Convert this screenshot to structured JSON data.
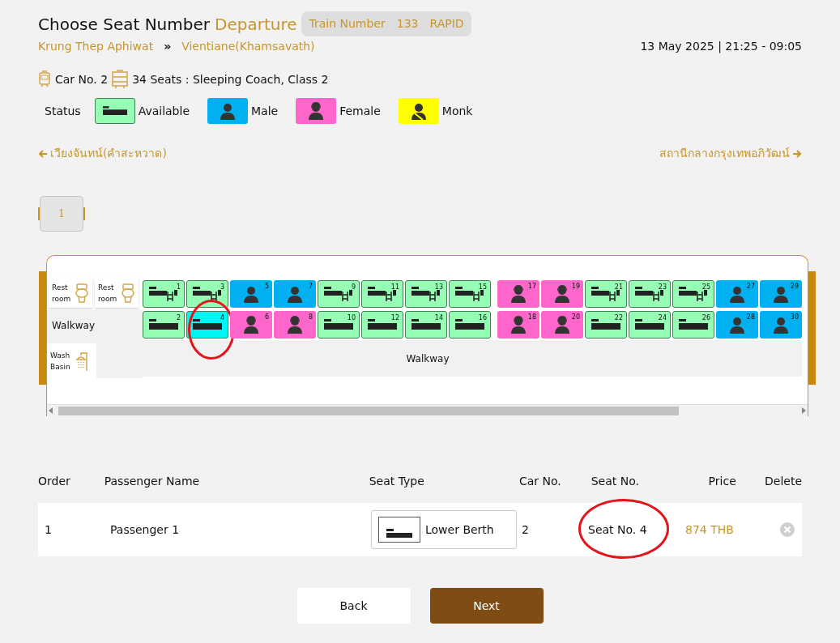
{
  "header": {
    "title": "Choose Seat Number",
    "direction": "Departure",
    "train_badge": {
      "label": "Train Number",
      "number": "133",
      "type": "RAPID"
    }
  },
  "route": {
    "origin": "Krung Thep Aphiwat",
    "separator": "»",
    "destination": "Vientiane(Khamsavath)",
    "datetime": "13 May 2025 | 21:25 - 09:05"
  },
  "car": {
    "car_no": "Car No. 2",
    "seats": "34 Seats : Sleeping Coach, Class 2"
  },
  "legend": {
    "label": "Status",
    "items": [
      {
        "label": "Available",
        "kind": "available"
      },
      {
        "label": "Male",
        "kind": "male"
      },
      {
        "label": "Female",
        "kind": "female"
      },
      {
        "label": "Monk",
        "kind": "monk"
      }
    ]
  },
  "direction_links": {
    "left": "เวียงจันทน์(คำสะหวาด)",
    "right": "สถานีกลางกรุงเทพอภิวัฒน์"
  },
  "car_tabs": [
    {
      "label": "1",
      "selected": false
    }
  ],
  "seat_map": {
    "facilities": [
      {
        "label": "Rest room",
        "kind": "toilet"
      },
      {
        "label": "Rest room",
        "kind": "toilet"
      }
    ],
    "walkway_side": "Walkway",
    "wash_basin": {
      "label": "Wash Basin",
      "kind": "basin"
    },
    "walkway_bottom": "Walkway",
    "upper": [
      {
        "number": "1",
        "kind": "available",
        "selected": false,
        "circled": false
      },
      {
        "number": "3",
        "kind": "available",
        "selected": false,
        "circled": false
      },
      {
        "number": "5",
        "kind": "male",
        "selected": false,
        "circled": false
      },
      {
        "number": "7",
        "kind": "male",
        "selected": false,
        "circled": false
      },
      {
        "number": "9",
        "kind": "available",
        "selected": false,
        "circled": false
      },
      {
        "number": "11",
        "kind": "available",
        "selected": false,
        "circled": false
      },
      {
        "number": "13",
        "kind": "available",
        "selected": false,
        "circled": false
      },
      {
        "number": "15",
        "kind": "available",
        "selected": false,
        "circled": false
      },
      {
        "number": "17",
        "kind": "female",
        "selected": false,
        "circled": false
      },
      {
        "number": "19",
        "kind": "female",
        "selected": false,
        "circled": false
      },
      {
        "number": "21",
        "kind": "available",
        "selected": false,
        "circled": false
      },
      {
        "number": "23",
        "kind": "available",
        "selected": false,
        "circled": false
      },
      {
        "number": "25",
        "kind": "available",
        "selected": false,
        "circled": false
      },
      {
        "number": "27",
        "kind": "male",
        "selected": false,
        "circled": false
      },
      {
        "number": "29",
        "kind": "male",
        "selected": false,
        "circled": false
      }
    ],
    "lower": [
      {
        "number": "2",
        "kind": "available",
        "selected": false,
        "circled": false
      },
      {
        "number": "4",
        "kind": "available",
        "selected": true,
        "circled": true
      },
      {
        "number": "6",
        "kind": "female",
        "selected": false,
        "circled": false
      },
      {
        "number": "8",
        "kind": "female",
        "selected": false,
        "circled": false
      },
      {
        "number": "10",
        "kind": "available",
        "selected": false,
        "circled": false
      },
      {
        "number": "12",
        "kind": "available",
        "selected": false,
        "circled": false
      },
      {
        "number": "14",
        "kind": "available",
        "selected": false,
        "circled": false
      },
      {
        "number": "16",
        "kind": "available",
        "selected": false,
        "circled": false
      },
      {
        "number": "18",
        "kind": "female",
        "selected": false,
        "circled": false
      },
      {
        "number": "20",
        "kind": "female",
        "selected": false,
        "circled": false
      },
      {
        "number": "22",
        "kind": "available",
        "selected": false,
        "circled": false
      },
      {
        "number": "24",
        "kind": "available",
        "selected": false,
        "circled": false
      },
      {
        "number": "26",
        "kind": "available",
        "selected": false,
        "circled": false
      },
      {
        "number": "28",
        "kind": "male",
        "selected": false,
        "circled": false
      },
      {
        "number": "30",
        "kind": "male",
        "selected": false,
        "circled": false
      }
    ]
  },
  "table": {
    "columns": [
      "Order",
      "Passenger Name",
      "Seat Type",
      "Car No.",
      "Seat No.",
      "Price",
      "Delete"
    ],
    "rows": [
      {
        "order": "1",
        "name": "Passenger 1",
        "seat_type": "Lower Berth",
        "car_no": "2",
        "seat_no": "Seat No. 4",
        "seat_no_circled": true,
        "price": "874 THB"
      }
    ]
  },
  "buttons": {
    "back": "Back",
    "next": "Next"
  }
}
